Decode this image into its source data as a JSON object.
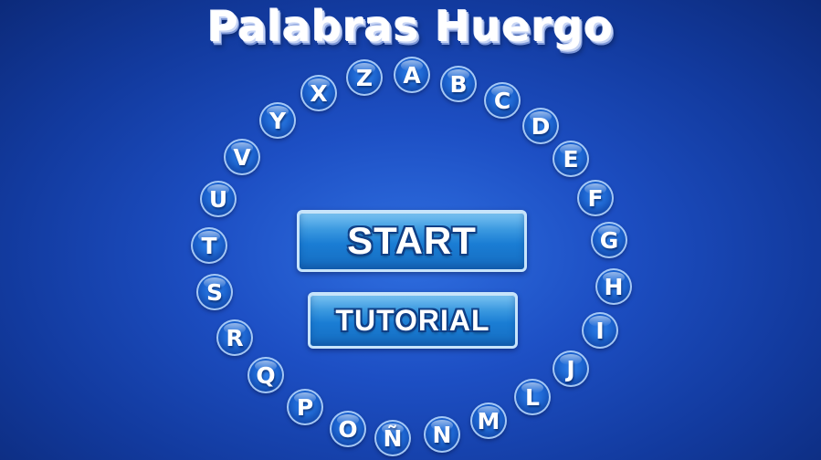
{
  "title": "Palabras Huergo",
  "letters": [
    "A",
    "B",
    "C",
    "D",
    "E",
    "F",
    "G",
    "H",
    "I",
    "J",
    "L",
    "M",
    "N",
    "Ñ",
    "O",
    "P",
    "Q",
    "R",
    "S",
    "T",
    "U",
    "V",
    "Y",
    "X",
    "Z"
  ],
  "buttons": {
    "start": "START",
    "tutorial": "TUTORIAL"
  },
  "colors": {
    "background": "#1d4fc4",
    "bubble": "#1a62cf",
    "button": "#1a7dd4",
    "text": "#ffffff"
  }
}
